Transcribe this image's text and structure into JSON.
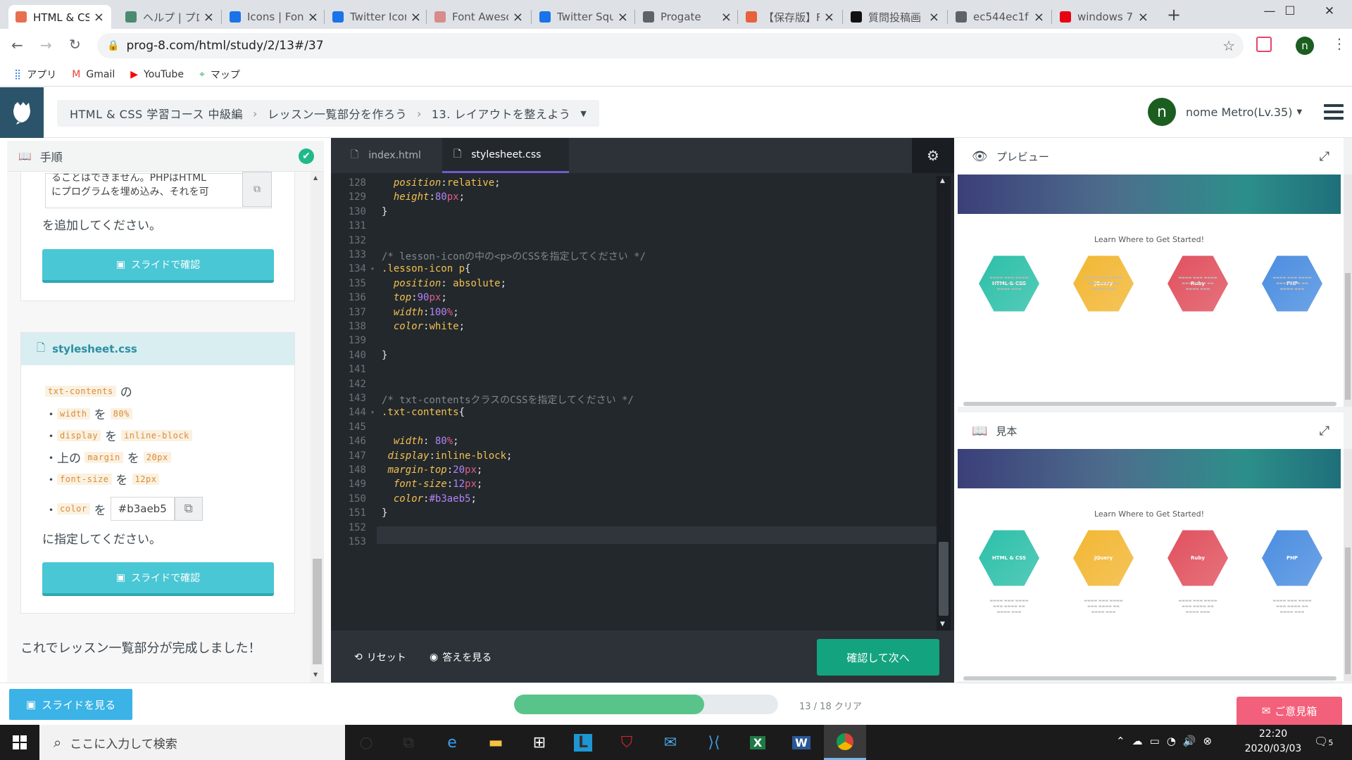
{
  "browser": {
    "tabs": [
      {
        "title": "HTML & CSS 学",
        "icon": "progate-favicon",
        "color": "#e76f51",
        "active": true
      },
      {
        "title": "ヘルプ | プロ",
        "icon": "progate-favicon",
        "color": "#4a8b6f",
        "active": false
      },
      {
        "title": "Icons | Font",
        "icon": "flag-favicon",
        "color": "#1a73e8",
        "active": false
      },
      {
        "title": "Twitter Icon",
        "icon": "flag-favicon",
        "color": "#1a73e8",
        "active": false
      },
      {
        "title": "Font Awesome",
        "icon": "fontawesome-favicon",
        "color": "#d88b8b",
        "active": false
      },
      {
        "title": "Twitter Squa",
        "icon": "flag-favicon",
        "color": "#1a73e8",
        "active": false
      },
      {
        "title": "Progate",
        "icon": "globe-favicon",
        "color": "#5f6368",
        "active": false
      },
      {
        "title": "【保存版】F",
        "icon": "ring-favicon",
        "color": "#e8603c",
        "active": false
      },
      {
        "title": "質問投稿画",
        "icon": "teratail-favicon",
        "color": "#111111",
        "active": false
      },
      {
        "title": "ec544ec1f",
        "icon": "globe-favicon",
        "color": "#5f6368",
        "active": false
      },
      {
        "title": "windows 7",
        "icon": "yahoo-favicon",
        "color": "#e60012",
        "active": false
      }
    ],
    "url": "prog-8.com/html/study/2/13#/37",
    "bookmarks": [
      {
        "label": "アプリ",
        "icon": "apps-grid-icon"
      },
      {
        "label": "Gmail",
        "icon": "gmail-icon"
      },
      {
        "label": "YouTube",
        "icon": "youtube-icon"
      },
      {
        "label": "マップ",
        "icon": "maps-icon"
      }
    ],
    "profile_initial": "n"
  },
  "header": {
    "breadcrumbs": [
      "HTML & CSS 学習コース 中級編",
      "レッスン一覧部分を作ろう",
      "13. レイアウトを整えよう"
    ],
    "user_initial": "n",
    "user_name": "nome Metro(Lv.35)"
  },
  "instructions": {
    "title": "手順",
    "code_preview_line1": "ることはできません。PHPはHTML",
    "code_preview_line2": "にプログラムを埋め込み、それを可",
    "add_text": "を追加してください。",
    "slide_button": "スライドで確認",
    "file_name": "stylesheet.css",
    "selector": "txt-contents",
    "no": "の",
    "wo": "を",
    "bullets": [
      {
        "prop": "width",
        "value": "80%"
      },
      {
        "prop": "display",
        "value": "inline-block"
      },
      {
        "prefix": "上の",
        "prop": "margin",
        "value": "20px"
      },
      {
        "prop": "font-size",
        "value": "12px"
      }
    ],
    "color_prop": "color",
    "color_value": "#b3aeb5",
    "specify_text": "に指定してください。",
    "slide_button2": "スライドで確認",
    "complete_text": "これでレッスン一覧部分が完成しました！"
  },
  "editor": {
    "tabs": [
      "index.html",
      "stylesheet.css"
    ],
    "active_tab": "stylesheet.css",
    "lines": [
      {
        "n": "128",
        "code": "  position:relative;"
      },
      {
        "n": "129",
        "code": "  height:80px;"
      },
      {
        "n": "130",
        "code": "}"
      },
      {
        "n": "131",
        "code": ""
      },
      {
        "n": "132",
        "code": ""
      },
      {
        "n": "133",
        "code": "/* lesson-iconの中の<p>のCSSを指定してください */"
      },
      {
        "n": "134",
        "code": ".lesson-icon p{"
      },
      {
        "n": "135",
        "code": "  position: absolute;"
      },
      {
        "n": "136",
        "code": "  top:90px;"
      },
      {
        "n": "137",
        "code": "  width:100%;"
      },
      {
        "n": "138",
        "code": "  color:white;"
      },
      {
        "n": "139",
        "code": ""
      },
      {
        "n": "140",
        "code": "}"
      },
      {
        "n": "141",
        "code": ""
      },
      {
        "n": "142",
        "code": ""
      },
      {
        "n": "143",
        "code": "/* txt-contentsクラスのCSSを指定してください */"
      },
      {
        "n": "144",
        "code": ".txt-contents{"
      },
      {
        "n": "145",
        "code": ""
      },
      {
        "n": "146",
        "code": "  width: 80%;"
      },
      {
        "n": "147",
        "code": " display:inline-block;"
      },
      {
        "n": "148",
        "code": " margin-top:20px;"
      },
      {
        "n": "149",
        "code": "  font-size:12px;"
      },
      {
        "n": "150",
        "code": "  color:#b3aeb5;"
      },
      {
        "n": "151",
        "code": "}"
      },
      {
        "n": "152",
        "code": ""
      },
      {
        "n": "153",
        "code": ""
      }
    ],
    "reset_label": "リセット",
    "answer_label": "答えを見る",
    "submit_label": "確認して次へ"
  },
  "preview": {
    "title": "プレビュー",
    "sample_title": "見本",
    "learn_text": "Learn Where to Get Started!",
    "icons": [
      {
        "label": "HTML & CSS",
        "color": "#2bbfa8"
      },
      {
        "label": "jQuery",
        "color": "#f2b632"
      },
      {
        "label": "Ruby",
        "color": "#e0505d"
      },
      {
        "label": "PHP",
        "color": "#4a8de0"
      }
    ]
  },
  "footer": {
    "slides_button": "スライドを見る",
    "progress": 0.72,
    "progress_text": "13 / 18 クリア",
    "opinion_button": "ご意見箱"
  },
  "taskbar": {
    "search_placeholder": "ここに入力して検索",
    "time": "22:20",
    "date": "2020/03/03",
    "notifications": "5"
  }
}
